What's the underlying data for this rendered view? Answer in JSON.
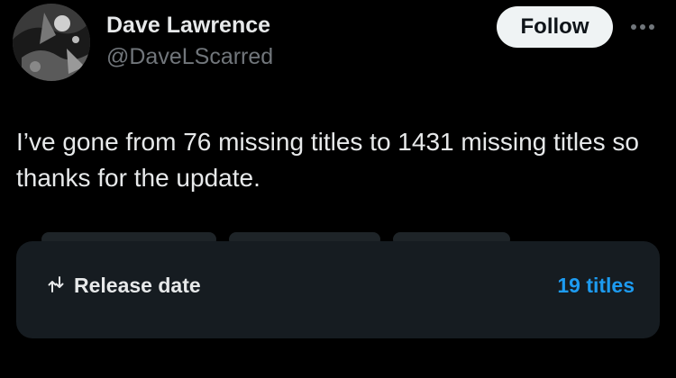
{
  "author": {
    "name": "Dave Lawrence",
    "handle": "@DaveLScarred",
    "avatar_icon": "profile-photo"
  },
  "actions": {
    "follow_label": "Follow",
    "more_icon": "more-dots-icon"
  },
  "tweet": {
    "text": "I’ve gone from 76 missing titles to 1431 missing titles so thanks for the update."
  },
  "card": {
    "icon": "sort-arrows-icon",
    "label": "Release date",
    "count": "19 titles",
    "count_color": "#1d9bf0"
  }
}
